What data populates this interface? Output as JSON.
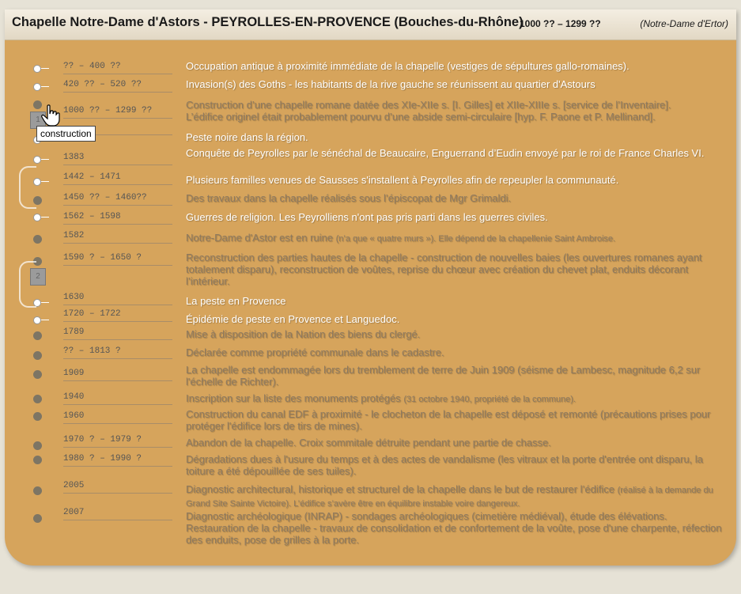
{
  "header": {
    "title": "Chapelle Notre-Dame d'Astors - PEYROLLES-EN-PROVENCE  (Bouches-du-Rhône)",
    "dates": "1000 ?? – 1299 ??",
    "alt_name": "(Notre-Dame d'Ertor)"
  },
  "tooltip": "construction",
  "segments": [
    "1",
    "2"
  ],
  "events": [
    {
      "date": "?? – 400 ??",
      "text": "Occupation antique à proximité immédiate de la chapelle (vestiges de sépultures gallo-romaines).",
      "note": "",
      "state": "active"
    },
    {
      "date": "420 ?? – 520 ??",
      "text": "Invasion(s) des Goths - les habitants de la rive gauche se réunissent au quartier d'Astours",
      "note": "",
      "state": "active"
    },
    {
      "date": "1000 ?? – 1299 ??",
      "text": "Construction d’une chapelle romane datée des XIe-XIIe s. [I. Gilles] et XIIe-XIIIe s. [service de l’Inventaire].\nL’édifice originel était probablement pourvu d’une abside semi-circulaire [hyp. F. Paone et P. Mellinand].",
      "note": "",
      "state": "dim"
    },
    {
      "date": "",
      "text": "Peste noire dans la région.",
      "note": "",
      "state": "active"
    },
    {
      "date": "1383",
      "text": "Conquête de Peyrolles par le sénéchal de Beaucaire, Enguerrand d’Eudin envoyé par le roi de France Charles VI.",
      "note": "",
      "state": "active"
    },
    {
      "date": "1442 – 1471",
      "text": "Plusieurs familles venues de Sausses s'installent à Peyrolles afin de repeupler la communauté.",
      "note": "",
      "state": "active"
    },
    {
      "date": "1450 ?? – 1460??",
      "text": "Des travaux dans la chapelle réalisés sous l’épiscopat de Mgr Grimaldi.",
      "note": "",
      "state": "dim"
    },
    {
      "date": "1562 – 1598",
      "text": "Guerres de religion. Les Peyrolliens n'ont pas pris parti dans les guerres civiles.",
      "note": "",
      "state": "active"
    },
    {
      "date": "1582",
      "text": "Notre-Dame d'Astor est en ruine ",
      "note": "(n’a que « quatre murs »). Elle dépend de la chapellenie Saint Ambroise.",
      "state": "dim"
    },
    {
      "date": "1590 ? – 1650 ?",
      "text": "Reconstruction des parties hautes de la chapelle -  construction de nouvelles baies (les ouvertures romanes ayant totalement disparu), reconstruction de voûtes, reprise du chœur avec création du chevet plat, enduits décorant l’intérieur.",
      "note": "",
      "state": "dim"
    },
    {
      "date": "1630",
      "text": "La peste en Provence",
      "note": "",
      "state": "active"
    },
    {
      "date": "1720 – 1722",
      "text": "Épidémie de peste en Provence et Languedoc.",
      "note": "",
      "state": "active"
    },
    {
      "date": "1789",
      "text": "Mise à disposition de la Nation des biens du clergé.",
      "note": "",
      "state": "dim"
    },
    {
      "date": "?? – 1813 ?",
      "text": "Déclarée comme propriété communale dans le cadastre.",
      "note": "",
      "state": "dim"
    },
    {
      "date": "1909",
      "text": "La chapelle est endommagée lors du tremblement de terre de Juin 1909 (séisme de Lambesc, magnitude 6,2 sur l'échelle de Richter).",
      "note": "",
      "state": "dim"
    },
    {
      "date": "1940",
      "text": "Inscription sur la liste des monuments protégés ",
      "note": "(31 octobre 1940, propriété de la commune).",
      "state": "dim"
    },
    {
      "date": "1960",
      "text": "Construction du canal EDF à proximité - le clocheton de la chapelle est déposé et remonté (précautions prises pour protéger l'édifice lors de tirs de mines).",
      "note": "",
      "state": "dim"
    },
    {
      "date": "1970 ? – 1979 ?",
      "text": "Abandon de la chapelle. Croix sommitale détruite pendant une partie de chasse.",
      "note": "",
      "state": "dim"
    },
    {
      "date": "1980 ? – 1990 ?",
      "text": "Dégradations dues à l'usure du temps et à des actes de vandalisme (les vitraux et la porte d'entrée ont disparu,  la toiture a été dépouillée de ses tuiles).",
      "note": "",
      "state": "dim"
    },
    {
      "date": "2005",
      "text": "Diagnostic architectural, historique et structurel de la chapelle dans le but de restaurer l’édifice ",
      "note": "(réalisé à la demande du Grand Site Sainte Victoire). L’édifice s’avère être en équilibre instable voire dangereux.",
      "state": "dim"
    },
    {
      "date": "2007",
      "text": "Diagnostic archéologique (INRAP) - sondages archéologiques (cimetière médiéval), étude des élévations.\nRestauration de la chapelle - travaux de consolidation et de confortement de la voûte, pose d'une charpente, réfection des enduits, pose de grilles à la porte.",
      "note": "",
      "state": "dim"
    }
  ]
}
